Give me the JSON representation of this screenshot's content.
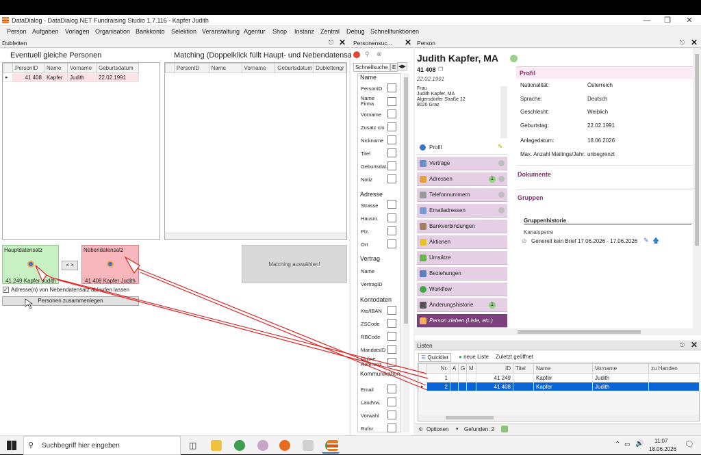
{
  "window": {
    "title": "DataDialog - DataDialog.NET Fundraising Studio 1.7.116 - Kapfer Judith"
  },
  "menu": [
    "Person",
    "Aufgaben",
    "Vorlagen",
    "Organisation",
    "Bankkonto",
    "Selektion",
    "Veranstaltung",
    "Agentur",
    "Shop",
    "Instanz",
    "Zentral",
    "Debug",
    "Schnellfunktionen"
  ],
  "dubletten": {
    "pane_title": "Dubletten",
    "left_heading": "Eventuell gleiche Personen",
    "right_heading": "Matching (Doppelklick füllt Haupt- und Nebendatensatz)",
    "left_columns": [
      "PersonID",
      "Name",
      "Vorname",
      "Geburtsdatum"
    ],
    "left_rows": [
      {
        "id": "41 408",
        "name": "Kapfer",
        "vorname": "Judith",
        "geb": "22.02.1991"
      }
    ],
    "right_columns": [
      "PersonID",
      "Name",
      "Vorname",
      "Geburtsdatum",
      "Dublettengr"
    ],
    "haupt_title": "Hauptdatensatz",
    "haupt_value": "41 249 Kapfer Judith",
    "neben_title": "Nebendatensatz",
    "neben_value": "41 408 Kapfer Judith",
    "swap_label": "< >",
    "matching_label": "Matching auswählen!",
    "checkbox_label": "Adresse(n) von Nebendatensatz ablaufen lassen",
    "merge_button": "Personen zusammenlegen"
  },
  "search": {
    "pane_title": "Personensuc...",
    "tab1": "Schnellsuche",
    "tab2": "E",
    "sec_name": "Name",
    "f_personid": "PersonID",
    "f_namefirma": "Name Firma",
    "f_vorname": "Vorname",
    "f_zusatz": "Zusatz c/o",
    "f_nickname": "Nickname",
    "f_titel": "Titel",
    "f_geb": "Geburtsdat.",
    "f_notiz": "Notiz",
    "sec_adresse": "Adresse",
    "f_strasse": "Strasse",
    "f_hausnr": "Hausnr.",
    "f_plz": "Plz.",
    "f_ort": "Ort",
    "sec_vertrag": "Vertrag",
    "f_vname": "Name",
    "f_vid": "VertragID",
    "sec_konto": "Kontodaten",
    "f_kto": "Kto/IBAN",
    "f_zs": "ZSCode",
    "f_rb": "RBCode",
    "f_mandat": "MandatsID",
    "f_online": "Online Referenz",
    "sec_komm": "Kommunikation",
    "f_email": "Email",
    "f_landvw": "LandVw.",
    "f_vorwahl": "Vorwahl",
    "f_rufnr": "Rufnr."
  },
  "person": {
    "pane_title": "Person",
    "name": "Judith Kapfer, MA",
    "id": "41 408",
    "dob": "22.02.1991",
    "address_lines": [
      "Frau",
      "Judith Kapfer, MA",
      "Algersdorfer Straße 12",
      "8020 Graz"
    ],
    "nav": [
      "Profil",
      "Verträge",
      "Adressen",
      "Telefonnummern",
      "Emailadressen",
      "Bankverbindungen",
      "Aktionen",
      "Umsätze",
      "Beziehungen",
      "Workflow",
      "Änderungshistorie",
      "Person ziehen (Liste, etc.)"
    ],
    "adressen_badge": "1",
    "aenderung_badge": "1",
    "profil_heading": "Profil",
    "profil": [
      {
        "k": "Nationalität:",
        "v": "Österreich"
      },
      {
        "k": "Sprache:",
        "v": "Deutsch"
      },
      {
        "k": "Geschlecht:",
        "v": "Weiblich"
      },
      {
        "k": "Geburtstag:",
        "v": "22.02.1991"
      },
      {
        "k": "Anlagedatum:",
        "v": "18.06.2026"
      },
      {
        "k": "Max. Anzahl Mailings/Jahr:",
        "v": "unbegrenzt"
      }
    ],
    "dokumente": "Dokumente",
    "gruppen": "Gruppen",
    "gruppenhistorie": "Gruppenhistorie",
    "kanal": "Kanalsperre",
    "kanal_entry": "Generell kein Brief  17.06.2026 - 17.06.2026"
  },
  "listen": {
    "pane_title": "Listen",
    "tabs": [
      "Quicklist",
      "neue Liste",
      "Zuletzt geöffnet"
    ],
    "columns": [
      "Nr.",
      "A",
      "G",
      "M",
      "ID",
      "Titel",
      "Name",
      "Vorname",
      "zu Handen"
    ],
    "rows": [
      {
        "nr": "1",
        "id": "41 249",
        "titel": "",
        "name": "Kapfer",
        "vorname": "Judith",
        "zh": ""
      },
      {
        "nr": "2",
        "id": "41 408",
        "titel": "",
        "name": "Kapfer",
        "vorname": "Judith",
        "zh": ""
      }
    ],
    "options": "Optionen",
    "found": "Gefunden: 2"
  },
  "taskbar": {
    "search": "Suchbegriff hier eingeben",
    "time": "11:07",
    "date": "18.06.2026"
  }
}
